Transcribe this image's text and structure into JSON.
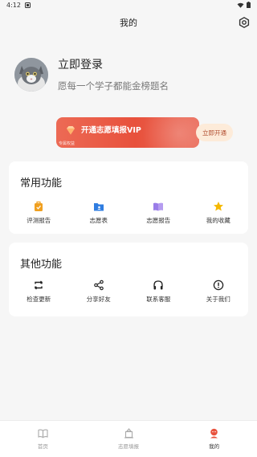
{
  "status_bar": {
    "time": "4:12"
  },
  "header": {
    "title": "我的"
  },
  "profile": {
    "login_title": "立即登录",
    "slogan": "愿每一个学子都能金榜题名"
  },
  "vip": {
    "title": "开通志愿填报VIP",
    "subtitle": "专属权益",
    "button": "立即开通"
  },
  "common_functions": {
    "title": "常用功能",
    "items": [
      {
        "label": "评测报告",
        "icon": "evaluation-report-icon"
      },
      {
        "label": "志愿表",
        "icon": "application-form-icon"
      },
      {
        "label": "志愿报告",
        "icon": "application-report-icon"
      },
      {
        "label": "我的收藏",
        "icon": "favorites-star-icon"
      }
    ]
  },
  "other_functions": {
    "title": "其他功能",
    "items": [
      {
        "label": "检查更新",
        "icon": "refresh-icon"
      },
      {
        "label": "分享好友",
        "icon": "share-icon"
      },
      {
        "label": "联系客服",
        "icon": "headphones-icon"
      },
      {
        "label": "关于我们",
        "icon": "info-icon"
      }
    ]
  },
  "bottom_nav": {
    "items": [
      {
        "label": "首页",
        "icon": "home-book-icon"
      },
      {
        "label": "志愿填报",
        "icon": "volunteer-fill-icon"
      },
      {
        "label": "我的",
        "icon": "profile-icon",
        "active": true
      }
    ]
  },
  "colors": {
    "accent_red": "#e8513c",
    "vip_button_bg": "#fdebd9",
    "icon_orange": "#f0a020",
    "icon_blue": "#2f7de1",
    "icon_purple": "#9a7de8",
    "icon_yellow": "#f5b800"
  }
}
